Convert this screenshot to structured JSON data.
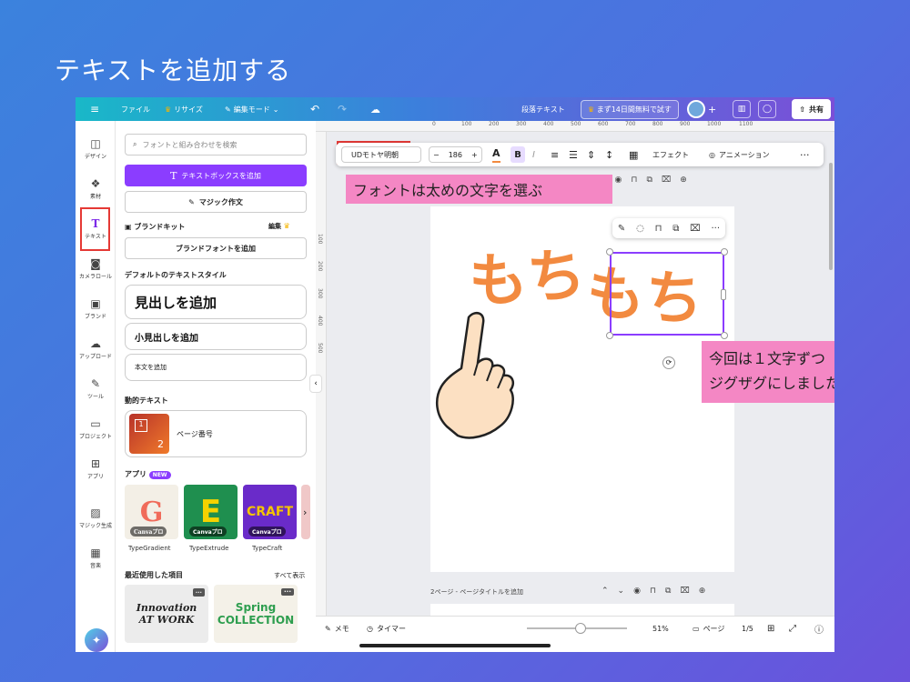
{
  "slide_title": "テキストを追加する",
  "topbar": {
    "menu_icon": "≡",
    "file": "ファイル",
    "resize": "リサイズ",
    "edit_mode": "編集モード",
    "doc_name": "段落テキスト",
    "trial": "まず14日間無料で試す",
    "share": "共有"
  },
  "rail": {
    "design": "デザイン",
    "elements": "素材",
    "text": "テキスト",
    "camera": "カメラロール",
    "brand": "ブランド",
    "upload": "アップロード",
    "tools": "ツール",
    "project": "プロジェクト",
    "apps": "アプリ",
    "magic_gen": "マジック生成",
    "audio": "音楽"
  },
  "panel": {
    "search_placeholder": "フォントと組み合わせを検索",
    "add_textbox": "テキストボックスを追加",
    "magic_write": "マジック作文",
    "brand_kit": "ブランドキット",
    "brand_edit": "編集",
    "add_brand_font": "ブランドフォントを追加",
    "default_styles_title": "デフォルトのテキストスタイル",
    "heading": "見出しを追加",
    "subheading": "小見出しを追加",
    "body": "本文を追加",
    "dynamic_title": "動的テキスト",
    "page_number": "ページ番号",
    "apps_title": "アプリ",
    "new_badge": "NEW",
    "apps": [
      {
        "name": "TypeGradient",
        "badge": "Canvaプロ",
        "letter": "G"
      },
      {
        "name": "TypeExtrude",
        "badge": "Canvaプロ",
        "letter": "E"
      },
      {
        "name": "TypeCraft",
        "badge": "Canvaプロ",
        "letter": "CRAFT"
      }
    ],
    "recent_title": "最近使用した項目",
    "see_all": "すべて表示",
    "recent_1": "Innovation AT WORK",
    "recent_2": "Spring COLLECTION"
  },
  "toolbar": {
    "font": "UDモトヤ明朝",
    "font_size": "186",
    "effects": "エフェクト",
    "animation": "アニメーション"
  },
  "ruler_h": [
    "0",
    "100",
    "200",
    "300",
    "400",
    "500",
    "600",
    "700",
    "800",
    "900",
    "1000",
    "1100"
  ],
  "ruler_v": [
    "100",
    "200",
    "300",
    "400",
    "500"
  ],
  "canvas": {
    "text_left": "もち",
    "text_right": "もち",
    "page2_label": "2ページ - ページタイトルを追加"
  },
  "notes": {
    "note1": "フォントは太めの文字を選ぶ",
    "note2_line1": "今回は１文字ずつ",
    "note2_line2": "ジグザグにしました"
  },
  "bottombar": {
    "memo": "メモ",
    "timer": "タイマー",
    "zoom": "51%",
    "page_label": "ページ",
    "page_count": "1/5",
    "zoom_level": 0.51
  },
  "colors": {
    "accent": "#8b3dff",
    "text_orange": "#f28a40",
    "note_pink": "#f487c4",
    "highlight_red": "#e53935"
  }
}
